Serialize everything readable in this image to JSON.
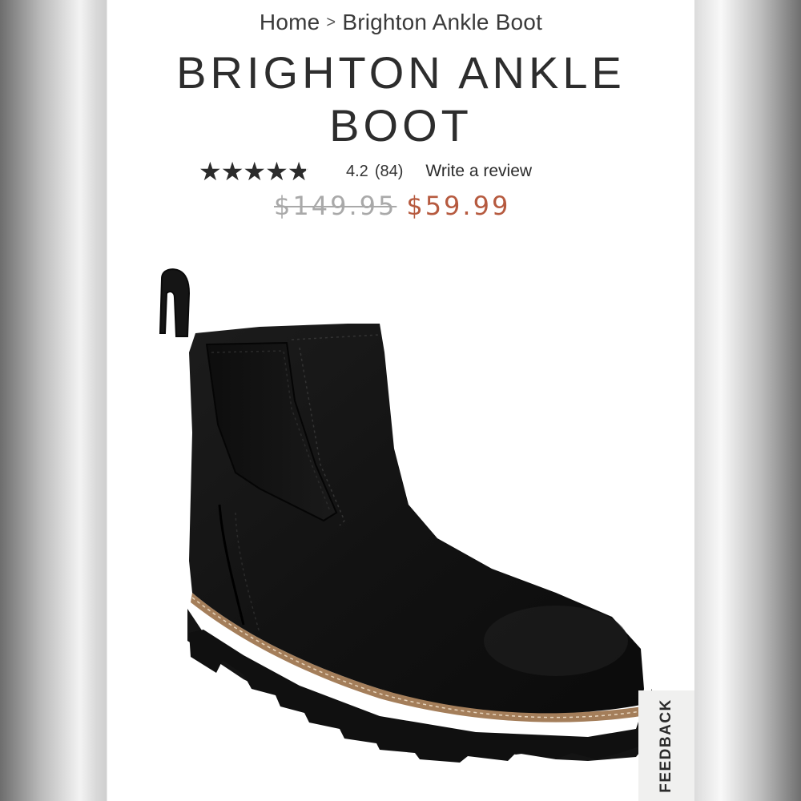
{
  "breadcrumb": {
    "home": "Home",
    "separator": ">",
    "current": "Brighton Ankle Boot"
  },
  "product": {
    "title": "BRIGHTON ANKLE BOOT",
    "rating": {
      "value": "4.2",
      "count": "(84)",
      "stars_fraction": 0.84,
      "write_review": "Write a review"
    },
    "price": {
      "original": "$149.95",
      "sale": "$59.99"
    },
    "image": {
      "icon": "black-suede-chelsea-ankle-boot"
    }
  },
  "feedback": {
    "label": "FEEDBACK"
  },
  "colors": {
    "sale_price": "#b65a3f",
    "original_price": "#a9a9a9",
    "text": "#2d2d2d"
  }
}
